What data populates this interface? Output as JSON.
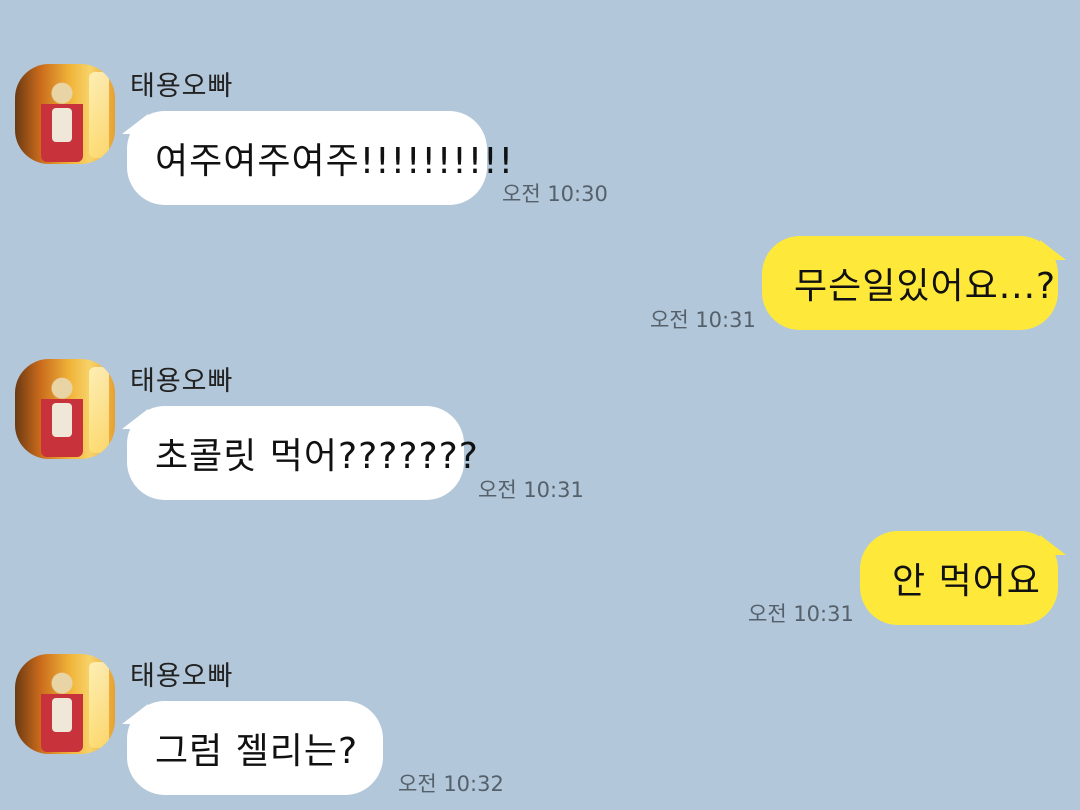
{
  "messages": [
    {
      "sender": "태용오빠",
      "text": "여주여주여주!!!!!!!!!!",
      "time": "오전 10:30"
    },
    {
      "text": "무슨일있어요...?",
      "time": "오전 10:31"
    },
    {
      "sender": "태용오빠",
      "text": "초콜릿 먹어???????",
      "time": "오전 10:31"
    },
    {
      "text": "안 먹어요",
      "time": "오전 10:31"
    },
    {
      "sender": "태용오빠",
      "text": "그럼 젤리는?",
      "time": "오전 10:32"
    }
  ],
  "colors": {
    "background": "#b2c7d9",
    "incoming_bubble": "#ffffff",
    "outgoing_bubble": "#fee93b"
  }
}
